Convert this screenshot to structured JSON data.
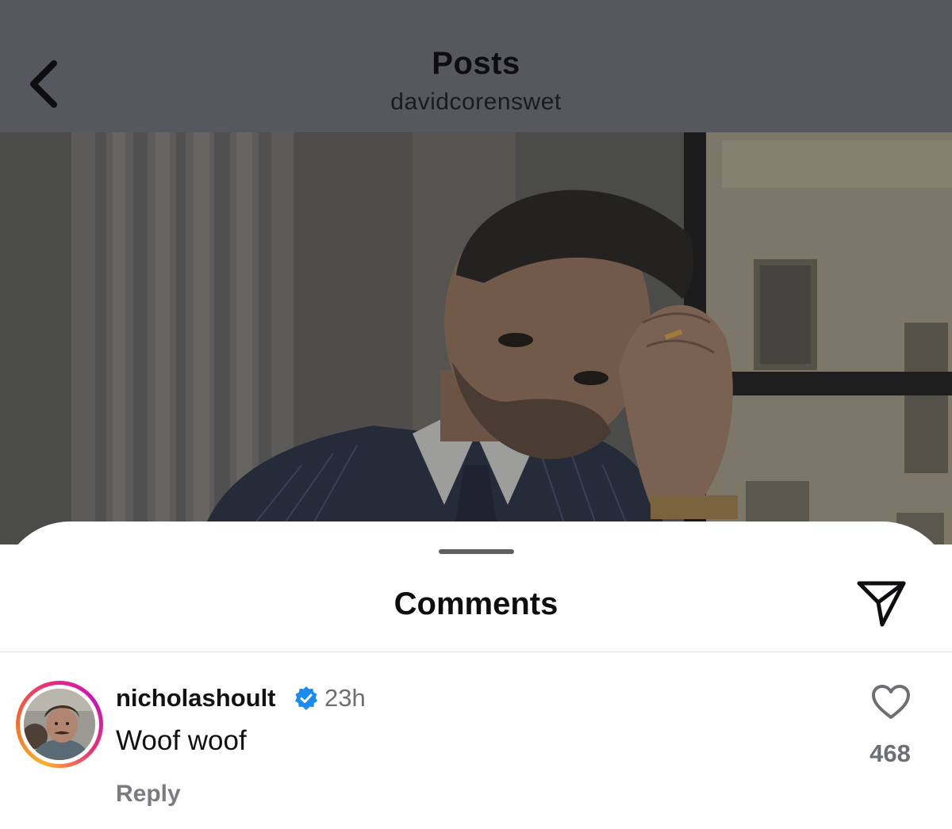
{
  "header": {
    "title": "Posts",
    "subtitle": "davidcorenswet",
    "back_icon": "chevron-left-icon"
  },
  "post": {
    "image": "photo of man in pinstripe suit touching his forehead, dimmed behind the comments sheet"
  },
  "comments_sheet": {
    "title": "Comments",
    "share_icon": "paper-plane-icon"
  },
  "comment": {
    "username": "nicholashoult",
    "verified": true,
    "timestamp": "23h",
    "text": "Woof woof",
    "reply_label": "Reply",
    "like_count": "468",
    "like_icon": "heart-outline-icon"
  },
  "colors": {
    "overlay_gray": "#57585d",
    "verified_blue": "#1a8cf0",
    "muted_text": "#6e6f74",
    "story_ring": [
      "#f9b12b",
      "#e8307a",
      "#c913b9"
    ]
  }
}
